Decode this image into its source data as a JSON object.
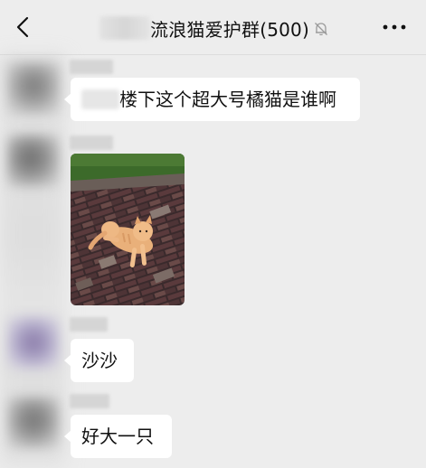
{
  "header": {
    "title": "流浪猫爱护群(500)",
    "back_icon": "chevron-left-icon",
    "mute_icon": "bell-muted-icon",
    "more_icon": "ellipsis-icon"
  },
  "messages": [
    {
      "type": "text",
      "prefix_blurred": true,
      "text": "楼下这个超大号橘猫是谁啊"
    },
    {
      "type": "image",
      "content": "orange cat lying on brick pavement"
    },
    {
      "type": "text",
      "text": "沙沙"
    },
    {
      "type": "text",
      "text": "好大一只"
    }
  ],
  "colors": {
    "background": "#ededed",
    "bubble": "#ffffff",
    "text": "#111111"
  }
}
